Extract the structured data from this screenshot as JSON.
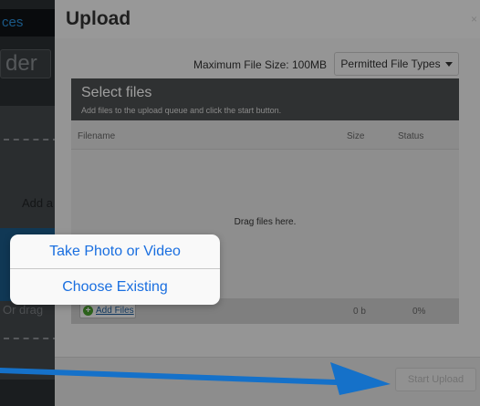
{
  "background": {
    "nav_text": "ces",
    "folder_text": "der",
    "add_text": "Add a",
    "drag_text": "Or drag"
  },
  "modal": {
    "title": "Upload",
    "close_label": "×",
    "max_file_size": "Maximum File Size: 100MB",
    "permitted_types_label": "Permitted File Types",
    "uploader": {
      "title": "Select files",
      "subtitle": "Add files to the upload queue and click the start button.",
      "columns": {
        "filename": "Filename",
        "size": "Size",
        "status": "Status"
      },
      "drop_text": "Drag files here.",
      "add_files_label": "Add Files",
      "total_size": "0 b",
      "total_status": "0%"
    },
    "start_upload_label": "Start Upload"
  },
  "popover": {
    "items": [
      {
        "label": "Take Photo or Video"
      },
      {
        "label": "Choose Existing"
      }
    ]
  },
  "colors": {
    "accent_blue": "#1a6fe0",
    "arrow_blue": "#1571c9",
    "header_dark": "#4d4f51"
  },
  "icons": {
    "add_files_icon": "plus-circle-icon",
    "dropdown_icon": "caret-down-icon",
    "close_icon": "close-icon",
    "annotation_arrow": "arrow-icon"
  }
}
